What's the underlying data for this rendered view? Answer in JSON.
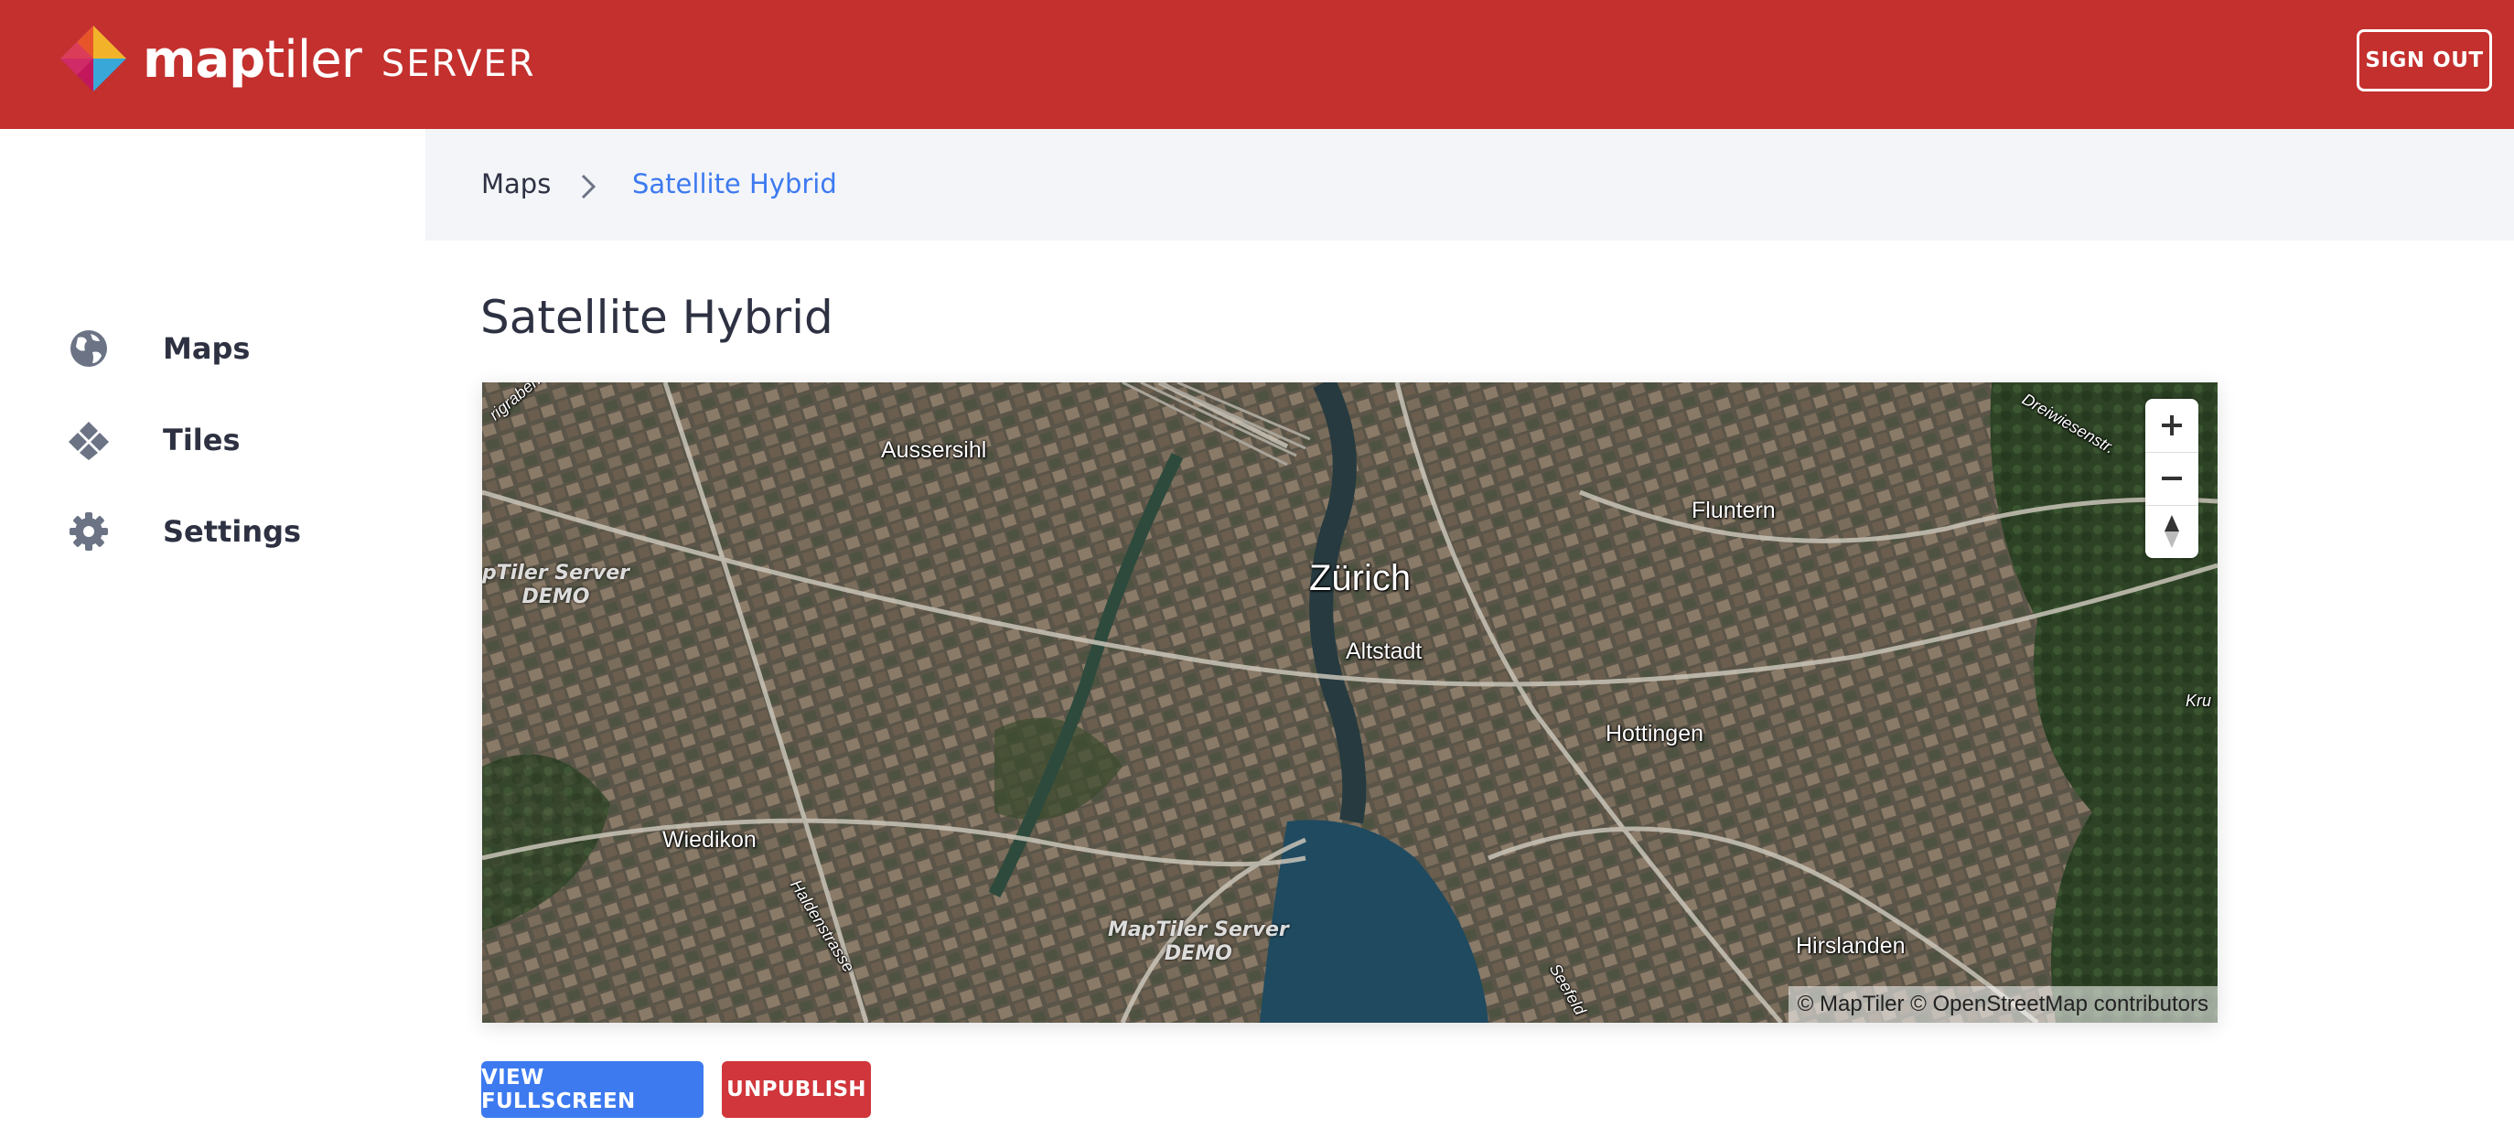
{
  "header": {
    "brand_name_bold": "map",
    "brand_name_light": "tiler",
    "brand_product": "SERVER",
    "signout_label": "SIGN OUT"
  },
  "sidebar": {
    "items": [
      {
        "label": "Maps",
        "icon": "globe-icon"
      },
      {
        "label": "Tiles",
        "icon": "tiles-icon"
      },
      {
        "label": "Settings",
        "icon": "gear-icon"
      }
    ]
  },
  "breadcrumb": {
    "parent": "Maps",
    "current": "Satellite Hybrid"
  },
  "page": {
    "title": "Satellite Hybrid"
  },
  "map": {
    "places": [
      {
        "name": "Zürich"
      },
      {
        "name": "Aussersihl"
      },
      {
        "name": "Altstadt"
      },
      {
        "name": "Fluntern"
      },
      {
        "name": "Hottingen"
      },
      {
        "name": "Wiedikon"
      },
      {
        "name": "Hirslanden"
      }
    ],
    "streets": [
      "Haldenstrasse",
      "Seefeld",
      "Dreiwiesenstr.",
      "Kru",
      "rigraben"
    ],
    "watermark_line1": "MapTiler Server",
    "watermark_line2": "DEMO",
    "watermark_partial_line1": "pTiler Server",
    "zoom_in_label": "+",
    "zoom_out_label": "−",
    "attribution": "© MapTiler © OpenStreetMap contributors"
  },
  "actions": {
    "fullscreen_label": "VIEW FULLSCREEN",
    "unpublish_label": "UNPUBLISH"
  },
  "colors": {
    "header_bg": "#c3302e",
    "accent_blue": "#3d7af0",
    "danger_red": "#d0363b",
    "breadcrumb_bg": "#f4f5f9",
    "text_dark": "#2d3142"
  }
}
